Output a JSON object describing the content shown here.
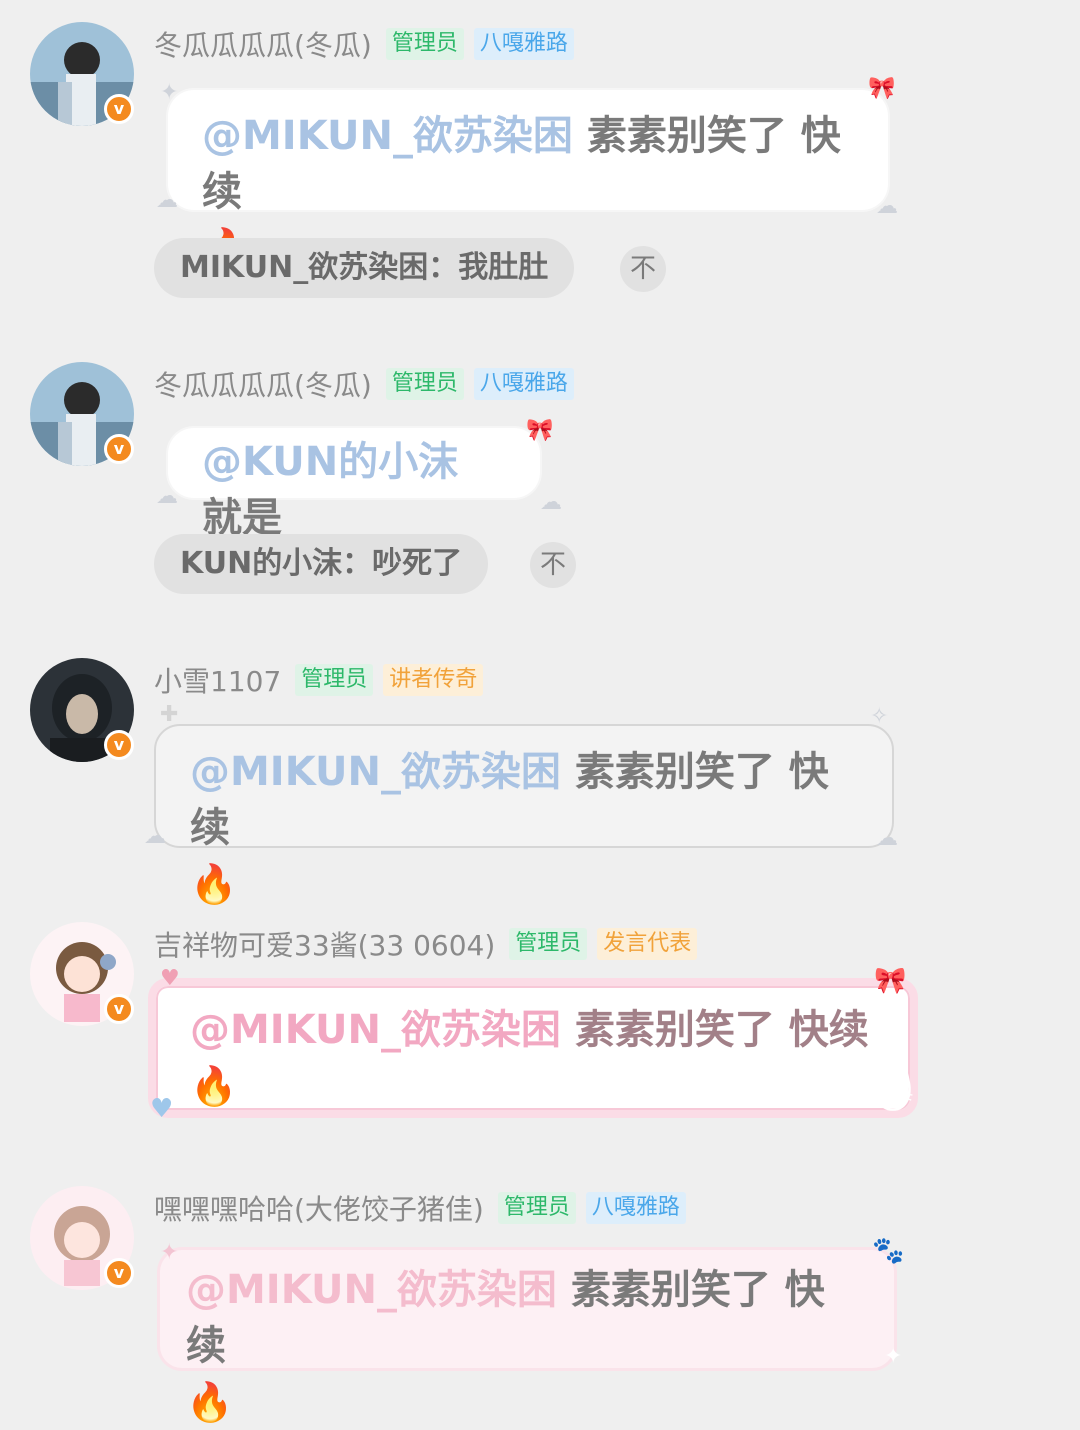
{
  "messages": [
    {
      "username": "冬瓜瓜瓜瓜(冬瓜)",
      "tags": [
        "管理员",
        "八嘎雅路"
      ],
      "mention": "@MIKUN_欲苏染困",
      "text": "素素别笑了 快续",
      "emoji": "🔥",
      "reply": "MIKUN_欲苏染困：我肚肚",
      "reply_icon": "不"
    },
    {
      "username": "冬瓜瓜瓜瓜(冬瓜)",
      "tags": [
        "管理员",
        "八嘎雅路"
      ],
      "mention": "@KUN的小沫",
      "text": "就是",
      "reply": "KUN的小沫：吵死了",
      "reply_icon": "不"
    },
    {
      "username": "小雪1107",
      "tags": [
        "管理员",
        "讲者传奇"
      ],
      "mention": "@MIKUN_欲苏染困",
      "text": "素素别笑了 快续",
      "emoji": "🔥"
    },
    {
      "username": "吉祥物可爱33酱(33 0604)",
      "tags": [
        "管理员",
        "发言代表"
      ],
      "mention": "@MIKUN_欲苏染困",
      "text": "素素别笑了 快续",
      "emoji": "🔥"
    },
    {
      "username": "嘿嘿嘿哈哈(大佬饺子猪佳)",
      "tags": [
        "管理员",
        "八嘎雅路"
      ],
      "mention": "@MIKUN_欲苏染困",
      "text": "素素别笑了 快续",
      "emoji": "🔥"
    }
  ],
  "badge": "v",
  "icons": [
    "verified-badge-icon",
    "pin-top-icon",
    "sparkle-icon",
    "bow-icon",
    "heart-icon",
    "wing-icon"
  ]
}
